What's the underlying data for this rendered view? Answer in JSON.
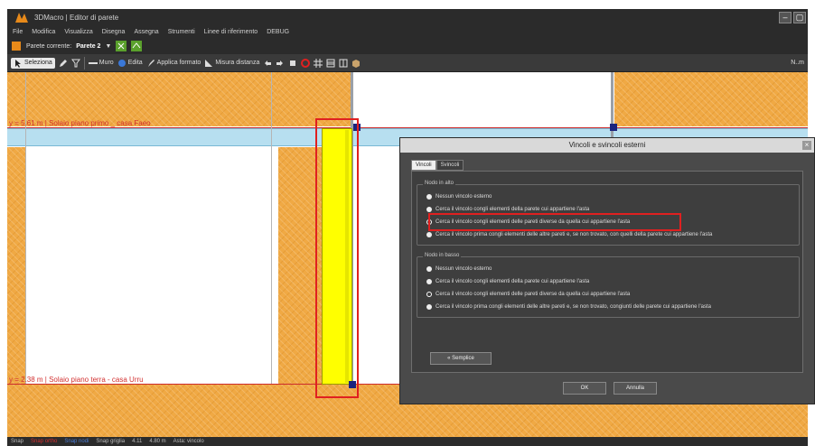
{
  "app": {
    "title": "3DMacro | Editor di parete",
    "min_label": "–",
    "max_label": "▢"
  },
  "menu": [
    "File",
    "Modifica",
    "Visualizza",
    "Disegna",
    "Assegna",
    "Strumenti",
    "Linee di riferimento",
    "DEBUG"
  ],
  "wall_row": {
    "label": "Parete corrente:",
    "value": "Parete 2",
    "arrow": "▼"
  },
  "toolbar": {
    "select": "Seleziona",
    "wall": "Muro",
    "edit": "Edita",
    "apply_format": "Applica formato",
    "measure": "Misura distanza",
    "right_label": "N..m"
  },
  "levels": {
    "top": "y = 5.61 m | Solaio piano primo _ casa Faeo",
    "bottom": "y = 2.38 m | Solaio piano terra - casa Urru"
  },
  "dialog": {
    "title": "Vincoli e svincoli esterni",
    "tabs": [
      "Vincoli",
      "Svincoli"
    ],
    "group_top": {
      "title": "Nodo in alto",
      "options": [
        "Nessun vincolo esterno",
        "Cerca il vincolo congli elementi della parete cui appartiene l'asta",
        "Cerca il vincolo congli elementi delle pareti diverse da quella cui appartiene l'asta",
        "Cerca il vincolo prima congli elementi delle altre pareti e, se non trovato, con quelli della parete cui appartiene l'asta"
      ],
      "selected_index": 2
    },
    "group_bottom": {
      "title": "Nodo in basso",
      "options": [
        "Nessun vincolo esterno",
        "Cerca il vincolo congli elementi della parete cui appartiene l'asta",
        "Cerca il vincolo congli elementi delle pareti diverse da quella cui appartiene l'asta",
        "Cerca il vincolo prima congli elementi delle altre pareti e, se non trovato, congiunti delle parete cui appartiene l'asta"
      ],
      "selected_index": 2
    },
    "simplify_button": "« Semplice",
    "ok_button": "OK",
    "cancel_button": "Annulla"
  },
  "status": [
    "Snap",
    "Snap ortho",
    "Snap nodi",
    "Snap griglia",
    "4.11",
    "4.80 m",
    "Asta: vincolo"
  ],
  "colors": {
    "masonry": "#f0a944",
    "slab": "#b7dff0",
    "bar": "#ffff00",
    "highlight": "#e02020",
    "level_text": "#d23030"
  }
}
